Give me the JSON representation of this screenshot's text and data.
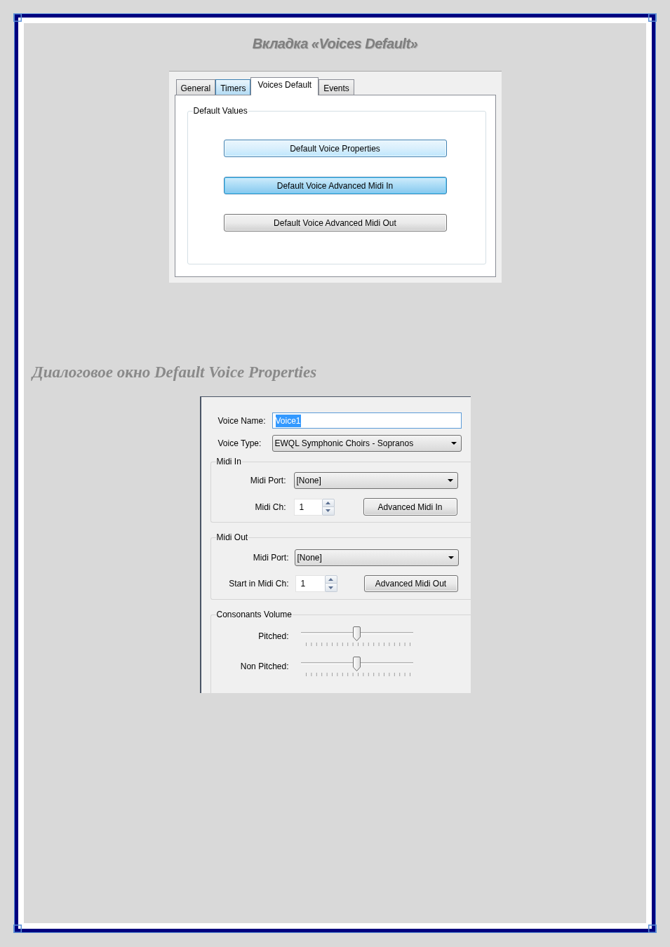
{
  "page_title": "Вкладка «Voices Default»",
  "tab_panel": {
    "tabs": [
      {
        "label": "General",
        "selected": false,
        "hovered": false
      },
      {
        "label": "Timers",
        "selected": false,
        "hovered": true
      },
      {
        "label": "Voices Default",
        "selected": true,
        "hovered": false
      },
      {
        "label": "Events",
        "selected": false,
        "hovered": false
      }
    ],
    "group": {
      "title": "Default Values",
      "buttons": [
        {
          "label": "Default Voice Properties",
          "hovered": true,
          "focused": false
        },
        {
          "label": "Default Voice Advanced Midi In",
          "hovered": true,
          "focused": true
        },
        {
          "label": "Default Voice Advanced Midi Out",
          "hovered": false,
          "focused": false
        }
      ]
    }
  },
  "dialog_caption": "Диалоговое окно Default Voice Properties",
  "dialog": {
    "voice_name": {
      "label": "Voice Name:",
      "value": "Voice1",
      "focused": true,
      "text_selected": true
    },
    "voice_type": {
      "label": "Voice Type:",
      "value": "EWQL Symphonic Choirs - Sopranos"
    },
    "midi_in": {
      "title": "Midi In",
      "port": {
        "label": "Midi Port:",
        "value": "[None]"
      },
      "channel": {
        "label": "Midi Ch:",
        "value": "1"
      },
      "button": "Advanced Midi In"
    },
    "midi_out": {
      "title": "Midi Out",
      "port": {
        "label": "Midi Port:",
        "value": "[None]"
      },
      "channel": {
        "label": "Start in Midi Ch:",
        "value": "1"
      },
      "button": "Advanced Midi Out"
    },
    "consonants_volume": {
      "title": "Consonants Volume",
      "sliders": [
        {
          "label": "Pitched:",
          "level": 0.5
        },
        {
          "label": "Non Pitched:",
          "level": 0.5
        }
      ]
    }
  }
}
